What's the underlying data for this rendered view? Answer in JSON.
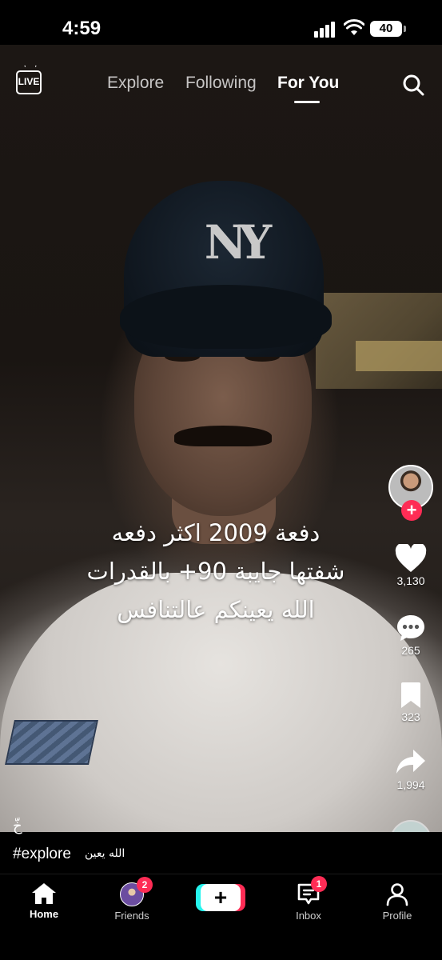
{
  "status_bar": {
    "time": "4:59",
    "battery": "40"
  },
  "top_nav": {
    "live_label": "LIVE",
    "tabs": [
      {
        "label": "Explore"
      },
      {
        "label": "Following"
      },
      {
        "label": "For You",
        "active": true
      }
    ]
  },
  "video": {
    "caption_lines": [
      "دفعة 2009 اكثر دفعه",
      "شفتها جايبة 90+ بالقدرات",
      "الله يعينكم عالتنافس"
    ]
  },
  "actions": {
    "likes": "3,130",
    "comments": "265",
    "saves": "323",
    "shares": "1,994"
  },
  "bottom_info": {
    "small_mark": "خّ",
    "hashtag": "#explore",
    "music_text": "الله يعين"
  },
  "bottom_nav": {
    "home": "Home",
    "friends": "Friends",
    "friends_badge": "2",
    "inbox": "Inbox",
    "inbox_badge": "1",
    "profile": "Profile",
    "create_symbol": "+"
  },
  "colors": {
    "accent": "#fe2c55",
    "cyan": "#25f4ee"
  }
}
